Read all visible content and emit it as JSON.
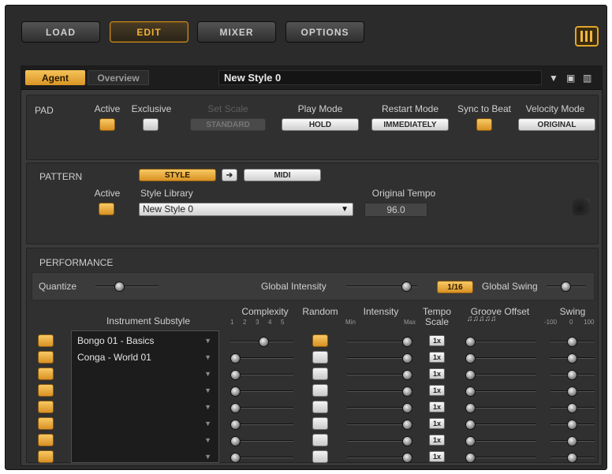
{
  "toolbar": {
    "load": "LOAD",
    "edit": "EDIT",
    "mixer": "MIXER",
    "options": "OPTIONS"
  },
  "tabs": {
    "agent": "Agent",
    "overview": "Overview",
    "style_name": "New Style 0"
  },
  "pad": {
    "title": "PAD",
    "active_label": "Active",
    "exclusive_label": "Exclusive",
    "set_scale_label": "Set Scale",
    "play_mode_label": "Play Mode",
    "play_mode": "HOLD",
    "restart_mode_label": "Restart Mode",
    "restart_mode": "IMMEDIATELY",
    "sync_label": "Sync to Beat",
    "velocity_label": "Velocity Mode",
    "velocity_mode": "ORIGINAL",
    "scale_value": "STANDARD"
  },
  "pattern": {
    "title": "PATTERN",
    "style_btn": "STYLE",
    "midi_btn": "MIDI",
    "active_label": "Active",
    "library_label": "Style Library",
    "library_value": "New Style 0",
    "tempo_label": "Original Tempo",
    "tempo_value": "96.0"
  },
  "performance": {
    "title": "PERFORMANCE",
    "quantize_label": "Quantize",
    "global_intensity_label": "Global Intensity",
    "grid_value": "1/16",
    "global_swing_label": "Global Swing",
    "headers": {
      "instrument": "Instrument Substyle",
      "complexity": "Complexity",
      "random": "Random",
      "intensity": "Intensity",
      "tempo_line1": "Tempo",
      "tempo_line2": "Scale",
      "groove": "Groove Offset",
      "swing": "Swing"
    },
    "complexity_ticks": [
      "1",
      "2",
      "3",
      "4",
      "5"
    ],
    "intensity_min": "Min",
    "intensity_max": "Max",
    "swing_ticks": [
      "-100",
      "0",
      "100"
    ],
    "rows": [
      {
        "instrument": "Bongo 01 - Basics",
        "tempo": "1x",
        "active": true,
        "random": true
      },
      {
        "instrument": "Conga - World 01",
        "tempo": "1x",
        "active": true,
        "random": false
      },
      {
        "instrument": "",
        "tempo": "1x",
        "active": true,
        "random": false
      },
      {
        "instrument": "",
        "tempo": "1x",
        "active": true,
        "random": false
      },
      {
        "instrument": "",
        "tempo": "1x",
        "active": true,
        "random": false
      },
      {
        "instrument": "",
        "tempo": "1x",
        "active": true,
        "random": false
      },
      {
        "instrument": "",
        "tempo": "1x",
        "active": true,
        "random": false
      },
      {
        "instrument": "",
        "tempo": "1x",
        "active": true,
        "random": false
      }
    ]
  },
  "colors": {
    "accent": "#f2b135",
    "panel": "#303030",
    "background": "#2b2b2b"
  },
  "icons": {
    "dropdown": "triangle-down-icon",
    "save": "save-icon",
    "delete": "trash-icon",
    "arrow": "arrow-right-icon",
    "drop_zone": "drop-zone-icon"
  }
}
